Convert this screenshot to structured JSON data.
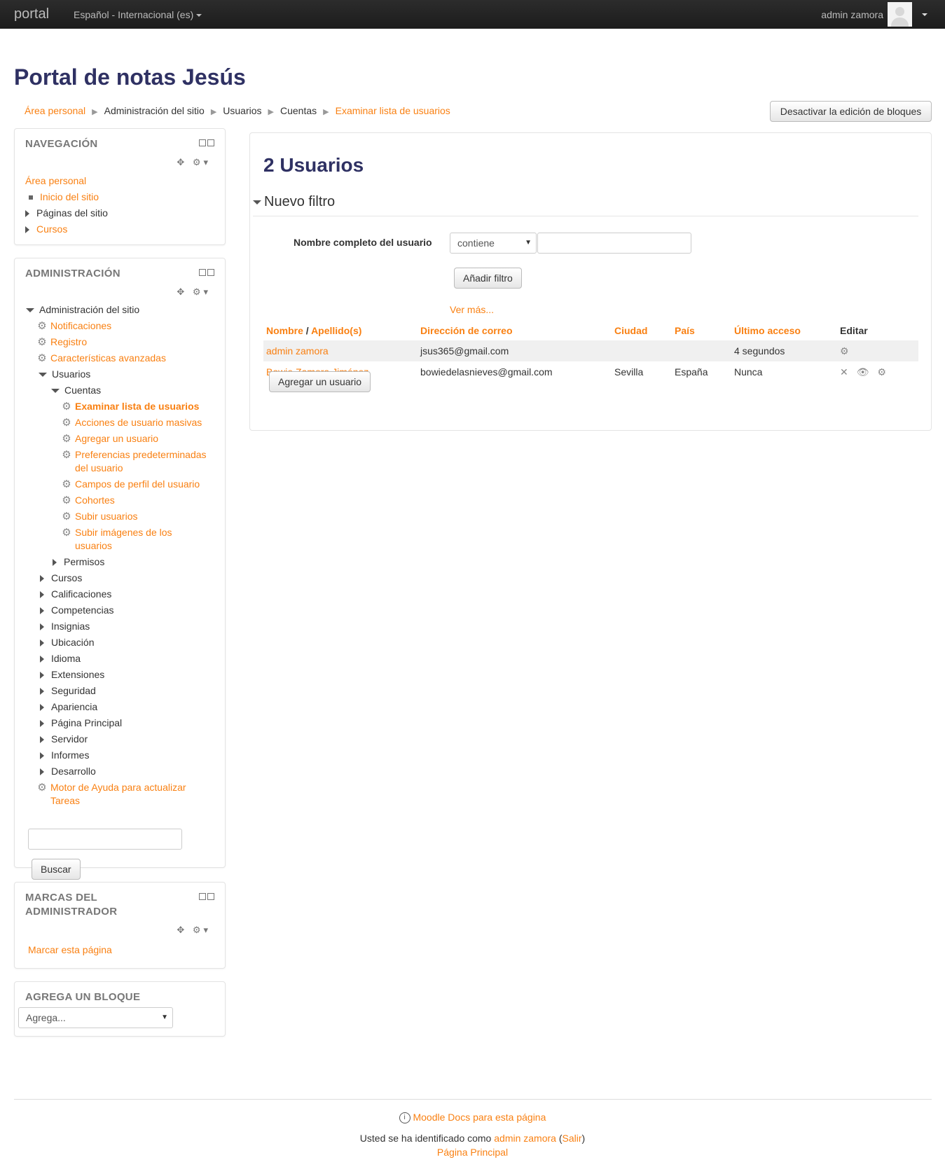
{
  "navbar": {
    "brand": "portal",
    "language": "Español - Internacional (es)",
    "user_name": "admin zamora"
  },
  "site_title": "Portal de notas Jesús",
  "breadcrumb": [
    "Área personal",
    "Administración del sitio",
    "Usuarios",
    "Cuentas",
    "Examinar lista de usuarios"
  ],
  "edit_blocks_button": "Desactivar la edición de bloques",
  "navigation_block": {
    "title": "NAVEGACIÓN",
    "items": [
      "Área personal",
      "Inicio del sitio",
      "Páginas del sitio",
      "Cursos"
    ]
  },
  "admin_block": {
    "title": "ADMINISTRACIÓN",
    "root": "Administración del sitio",
    "notificaciones": "Notificaciones",
    "registro": "Registro",
    "caracteristicas": "Características avanzadas",
    "usuarios": "Usuarios",
    "cuentas": "Cuentas",
    "cuentas_items": [
      "Examinar lista de usuarios",
      "Acciones de usuario masivas",
      "Agregar un usuario",
      "Preferencias predeterminadas del usuario",
      "Campos de perfil del usuario",
      "Cohortes",
      "Subir usuarios",
      "Subir imágenes de los usuarios"
    ],
    "permisos": "Permisos",
    "sections": [
      "Cursos",
      "Calificaciones",
      "Competencias",
      "Insignias",
      "Ubicación",
      "Idioma",
      "Extensiones",
      "Seguridad",
      "Apariencia",
      "Página Principal",
      "Servidor",
      "Informes",
      "Desarrollo"
    ],
    "motor": "Motor de Ayuda para actualizar Tareas",
    "search_button": "Buscar"
  },
  "bookmarks_block": {
    "title_line1": "MARCAS DEL",
    "title_line2": "ADMINISTRADOR",
    "link": "Marcar esta página"
  },
  "add_block": {
    "title": "AGREGA UN BLOQUE",
    "select_value": "Agrega..."
  },
  "main": {
    "heading": "2 Usuarios",
    "filter_legend": "Nuevo filtro",
    "filter_label": "Nombre completo del usuario",
    "filter_operator": "contiene",
    "add_filter_button": "Añadir filtro",
    "more_link": "Ver más...",
    "table": {
      "headers": {
        "nombre": "Nombre",
        "slash": "/",
        "apellido": "Apellido(s)",
        "email": "Dirección de correo",
        "ciudad": "Ciudad",
        "pais": "País",
        "acceso": "Último acceso",
        "editar": "Editar"
      },
      "rows": [
        {
          "name": "admin zamora",
          "email": "jsus365@gmail.com",
          "city": "",
          "country": "",
          "last_access": "4 segundos"
        },
        {
          "name": "Bowie Zamora Jiménez",
          "email": "bowiedelasnieves@gmail.com",
          "city": "Sevilla",
          "country": "España",
          "last_access": "Nunca"
        }
      ]
    },
    "add_user_button": "Agregar un usuario"
  },
  "footer": {
    "docs_link": "Moodle Docs para esta página",
    "logged_prefix": "Usted se ha identificado como",
    "logged_user": "admin zamora",
    "paren_open": "(",
    "logout": "Salir",
    "paren_close": ")",
    "home_link": "Página Principal"
  },
  "colors": {
    "accent": "#f98012",
    "heading": "#2f3163",
    "navbar": "#222222"
  }
}
